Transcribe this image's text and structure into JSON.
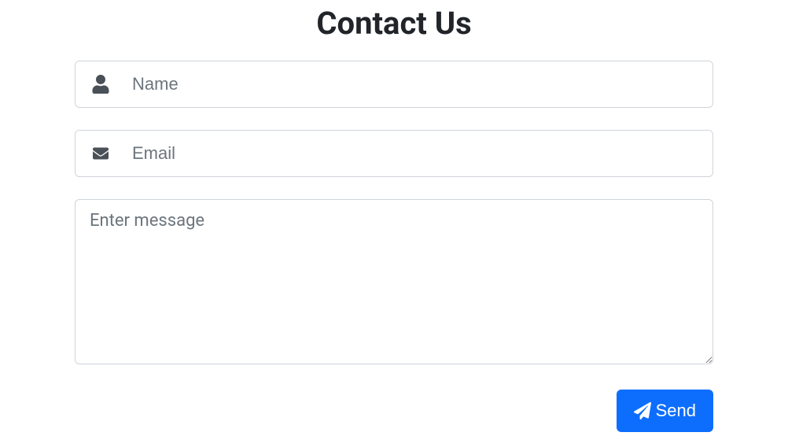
{
  "title": "Contact Us",
  "form": {
    "name": {
      "placeholder": "Name",
      "value": "",
      "icon": "user-icon"
    },
    "email": {
      "placeholder": "Email",
      "value": "",
      "icon": "envelope-icon"
    },
    "message": {
      "placeholder": "Enter message",
      "value": ""
    },
    "submit": {
      "label": "Send",
      "icon": "paper-plane-icon"
    }
  },
  "colors": {
    "primary": "#0d6efd",
    "border": "#ced4da",
    "text": "#212529",
    "placeholder": "#6c757d",
    "iconColor": "#495057"
  }
}
